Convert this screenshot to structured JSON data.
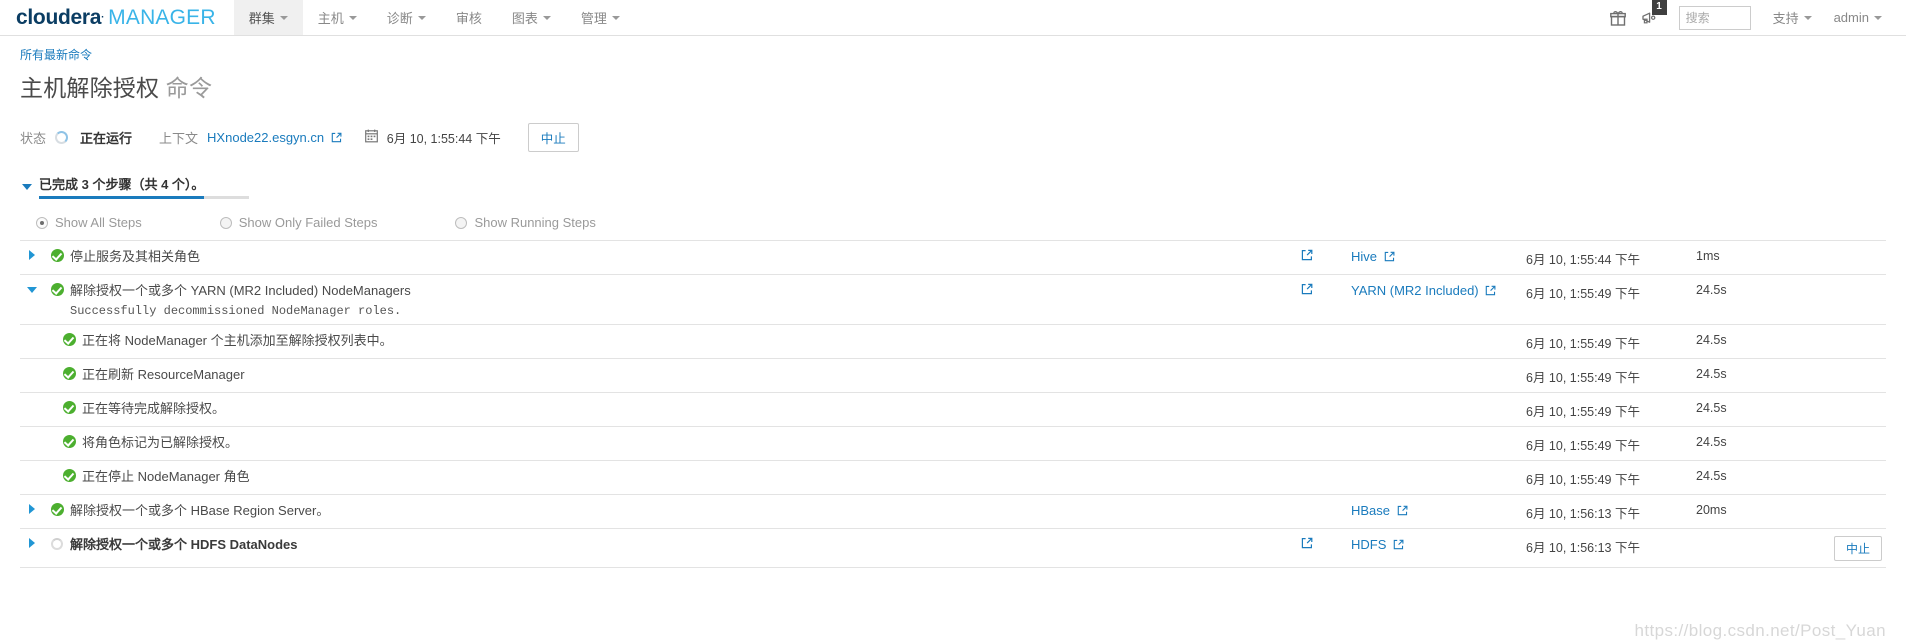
{
  "brand": {
    "part1": "cloudera",
    "registered": "·",
    "part2": "MANAGER"
  },
  "nav": {
    "items": [
      {
        "label": "群集",
        "has_caret": true,
        "active": true
      },
      {
        "label": "主机",
        "has_caret": true,
        "active": false
      },
      {
        "label": "诊断",
        "has_caret": true,
        "active": false
      },
      {
        "label": "审核",
        "has_caret": false,
        "active": false
      },
      {
        "label": "图表",
        "has_caret": true,
        "active": false
      },
      {
        "label": "管理",
        "has_caret": true,
        "active": false
      }
    ],
    "gift_icon": "gift-icon",
    "announce_icon": "announcement-icon",
    "announce_badge": "1",
    "search_placeholder": "搜索",
    "search_value": "",
    "support_label": "支持",
    "user_label": "admin"
  },
  "header": {
    "breadcrumb": "所有最新命令",
    "title": "主机解除授权",
    "title_suffix": "命令"
  },
  "status": {
    "state_label": "状态",
    "state_value": "正在运行",
    "context_label": "上下文",
    "context_value": "HXnode22.esgyn.cn",
    "timestamp": "6月 10, 1:55:44 下午",
    "abort_label": "中止"
  },
  "summary": {
    "text": "已完成 3 个步骤（共 4 个）。",
    "completed": 3,
    "total": 4
  },
  "filters": [
    {
      "label": "Show All Steps",
      "checked": true
    },
    {
      "label": "Show Only Failed Steps",
      "checked": false
    },
    {
      "label": "Show Running Steps",
      "checked": false
    }
  ],
  "steps": [
    {
      "toggle": "right",
      "state": "check",
      "title": "停止服务及其相关角色",
      "message": "",
      "bold": false,
      "sub": false,
      "has_leading_ext": true,
      "service": "Hive",
      "timestamp": "6月 10, 1:55:44 下午",
      "duration": "1ms",
      "action": ""
    },
    {
      "toggle": "down",
      "state": "check",
      "title": "解除授权一个或多个 YARN (MR2 Included) NodeManagers",
      "message": "Successfully decommissioned NodeManager roles.",
      "bold": false,
      "sub": false,
      "has_leading_ext": true,
      "service": "YARN (MR2 Included)",
      "timestamp": "6月 10, 1:55:49 下午",
      "duration": "24.5s",
      "action": ""
    },
    {
      "toggle": "",
      "state": "check",
      "title": "正在将 NodeManager 个主机添加至解除授权列表中。",
      "message": "",
      "bold": false,
      "sub": true,
      "has_leading_ext": false,
      "service": "",
      "timestamp": "6月 10, 1:55:49 下午",
      "duration": "24.5s",
      "action": ""
    },
    {
      "toggle": "",
      "state": "check",
      "title": "正在刷新 ResourceManager",
      "message": "",
      "bold": false,
      "sub": true,
      "has_leading_ext": false,
      "service": "",
      "timestamp": "6月 10, 1:55:49 下午",
      "duration": "24.5s",
      "action": ""
    },
    {
      "toggle": "",
      "state": "check",
      "title": "正在等待完成解除授权。",
      "message": "",
      "bold": false,
      "sub": true,
      "has_leading_ext": false,
      "service": "",
      "timestamp": "6月 10, 1:55:49 下午",
      "duration": "24.5s",
      "action": ""
    },
    {
      "toggle": "",
      "state": "check",
      "title": "将角色标记为已解除授权。",
      "message": "",
      "bold": false,
      "sub": true,
      "has_leading_ext": false,
      "service": "",
      "timestamp": "6月 10, 1:55:49 下午",
      "duration": "24.5s",
      "action": ""
    },
    {
      "toggle": "",
      "state": "check",
      "title": "正在停止 NodeManager 角色",
      "message": "",
      "bold": false,
      "sub": true,
      "has_leading_ext": false,
      "service": "",
      "timestamp": "6月 10, 1:55:49 下午",
      "duration": "24.5s",
      "action": ""
    },
    {
      "toggle": "right",
      "state": "check",
      "title": "解除授权一个或多个 HBase Region Server。",
      "message": "",
      "bold": false,
      "sub": false,
      "has_leading_ext": false,
      "service": "HBase",
      "timestamp": "6月 10, 1:56:13 下午",
      "duration": "20ms",
      "action": ""
    },
    {
      "toggle": "right",
      "state": "spinner",
      "title": "解除授权一个或多个 HDFS DataNodes",
      "message": "",
      "bold": true,
      "sub": false,
      "has_leading_ext": true,
      "service": "HDFS",
      "timestamp": "6月 10, 1:56:13 下午",
      "duration": "",
      "action": "中止"
    }
  ],
  "watermark": "https://blog.csdn.net/Post_Yuan",
  "colors": {
    "brand_dark": "#0b3d63",
    "brand_light": "#39b4e8",
    "link": "#1a7bbd",
    "success": "#4caf2f",
    "accent": "#2196d4"
  }
}
